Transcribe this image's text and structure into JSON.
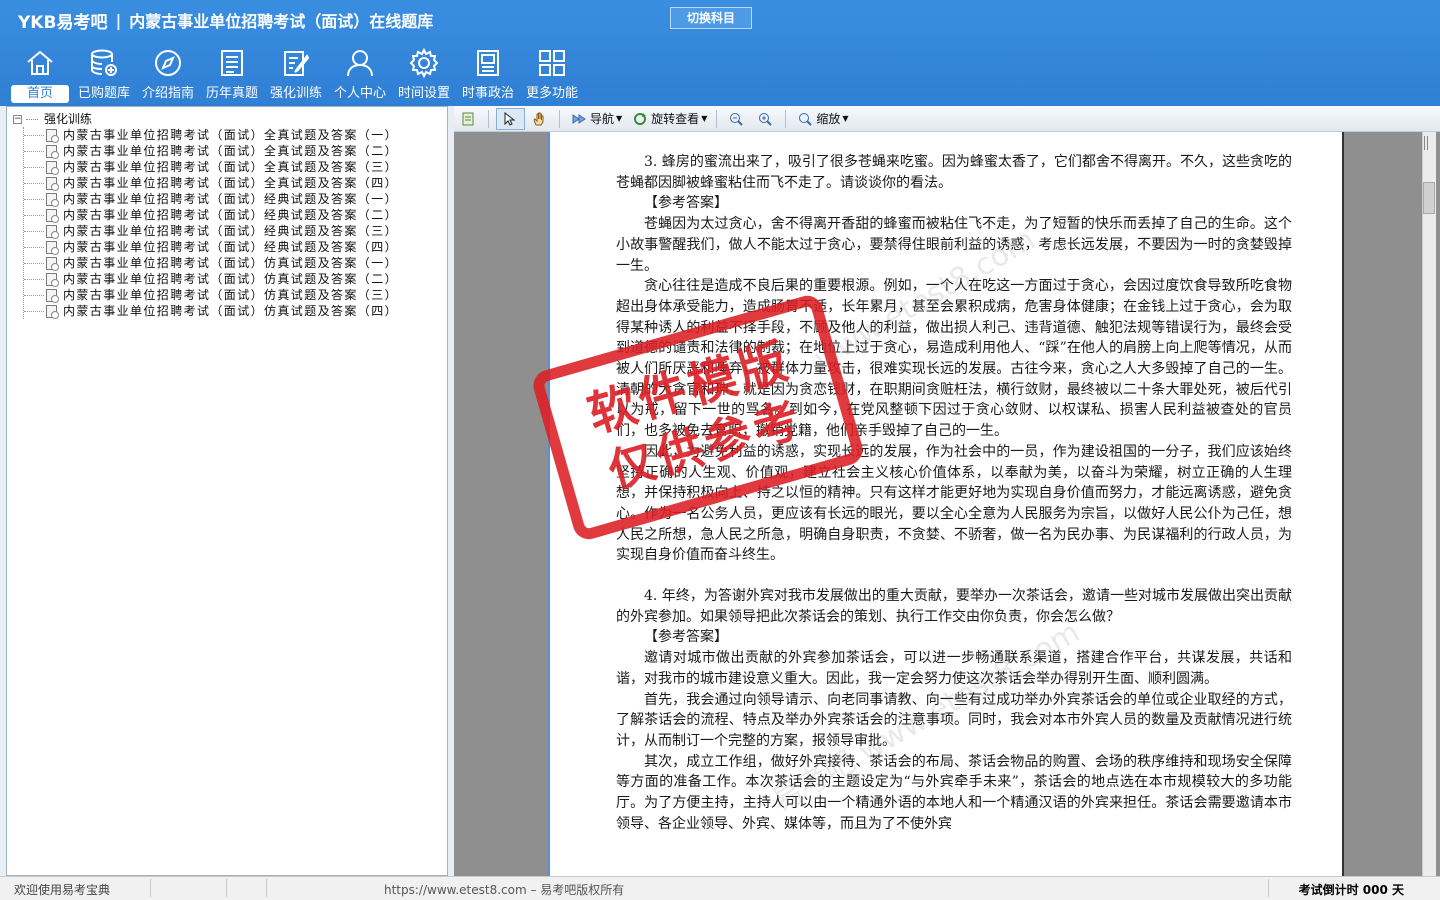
{
  "header": {
    "brand": "YKB易考吧",
    "separator": "|",
    "title": "内蒙古事业单位招聘考试（面试）在线题库",
    "switch_label": "切换科目"
  },
  "nav": [
    {
      "label": "首页",
      "icon": "home-icon"
    },
    {
      "label": "已购题库",
      "icon": "database-icon"
    },
    {
      "label": "介绍指南",
      "icon": "compass-icon"
    },
    {
      "label": "历年真题",
      "icon": "document-list-icon"
    },
    {
      "label": "强化训练",
      "icon": "edit-icon"
    },
    {
      "label": "个人中心",
      "icon": "user-icon"
    },
    {
      "label": "时间设置",
      "icon": "gear-icon"
    },
    {
      "label": "时事政治",
      "icon": "book-icon"
    },
    {
      "label": "更多功能",
      "icon": "grid-icon"
    }
  ],
  "tree": {
    "root": "强化训练",
    "items": [
      "内蒙古事业单位招聘考试（面试）全真试题及答案（一）",
      "内蒙古事业单位招聘考试（面试）全真试题及答案（二）",
      "内蒙古事业单位招聘考试（面试）全真试题及答案（三）",
      "内蒙古事业单位招聘考试（面试）全真试题及答案（四）",
      "内蒙古事业单位招聘考试（面试）经典试题及答案（一）",
      "内蒙古事业单位招聘考试（面试）经典试题及答案（二）",
      "内蒙古事业单位招聘考试（面试）经典试题及答案（三）",
      "内蒙古事业单位招聘考试（面试）经典试题及答案（四）",
      "内蒙古事业单位招聘考试（面试）仿真试题及答案（一）",
      "内蒙古事业单位招聘考试（面试）仿真试题及答案（二）",
      "内蒙古事业单位招聘考试（面试）仿真试题及答案（三）",
      "内蒙古事业单位招聘考试（面试）仿真试题及答案（四）"
    ]
  },
  "toolbar": {
    "nav_label": "导航",
    "rotate_label": "旋转查看",
    "zoom_label": "缩放"
  },
  "document": {
    "paragraphs": [
      {
        "text": "3. 蜂房的蜜流出来了，吸引了很多苍蝇来吃蜜。因为蜂蜜太香了，它们都舍不得离开。不久，这些贪吃的苍蝇都因脚被蜂蜜粘住而飞不走了。请谈谈你的看法。",
        "indent": true
      },
      {
        "text": "【参考答案】",
        "indent": true
      },
      {
        "text": "苍蝇因为太过贪心，舍不得离开香甜的蜂蜜而被粘住飞不走，为了短暂的快乐而丢掉了自己的生命。这个小故事警醒我们，做人不能太过于贪心，要禁得住眼前利益的诱惑，考虑长远发展，不要因为一时的贪婪毁掉一生。",
        "indent": true
      },
      {
        "text": "贪心往往是造成不良后果的重要根源。例如，一个人在吃这一方面过于贪心，会因过度饮食导致所吃食物超出身体承受能力，造成肠胃不适，长年累月，甚至会累积成病，危害身体健康；在金钱上过于贪心，会为取得某种诱人的利益不择手段，不顾及他人的利益，做出损人利己、违背道德、触犯法规等错误行为，最终会受到道德的谴责和法律的制裁；在地位上过于贪心，易造成利用他人、“踩”在他人的肩膀上向上爬等情况，从而被人们所厌恶和唾弃，被群体力量攻击，很难实现长远的发展。古往今来，贪心之人大多毁掉了自己的一生。清朝的大贪官和珅，就是因为贪恋钱财，在职期间贪赃枉法，横行敛财，最终被以二十条大罪处死，被后代引以为戒，留下一世的骂名。到如今，在党风整顿下因过于贪心敛财、以权谋私、损害人民利益被查处的官员们，也多被免去官职，撤销党籍，他们亲手毁掉了自己的一生。",
        "indent": true
      },
      {
        "text": "因此，为避免利益的诱惑，实现长远的发展，作为社会中的一员，作为建设祖国的一分子，我们应该始终坚持正确的人生观、价值观，建立社会主义核心价值体系，以奉献为美，以奋斗为荣耀，树立正确的人生理想，并保持积极向上、持之以恒的精神。只有这样才能更好地为实现自身价值而努力，才能远离诱惑，避免贪心。作为一名公务人员，更应该有长远的眼光，要以全心全意为人民服务为宗旨，以做好人民公仆为己任，想人民之所想，急人民之所急，明确自身职责，不贪婪、不骄奢，做一名为民办事、为民谋福利的行政人员，为实现自身价值而奋斗终生。",
        "indent": true
      },
      {
        "text": "",
        "gap": true
      },
      {
        "text": "4. 年终，为答谢外宾对我市发展做出的重大贡献，要举办一次茶话会，邀请一些对城市发展做出突出贡献的外宾参加。如果领导把此次茶话会的策划、执行工作交由你负责，你会怎么做？",
        "indent": true
      },
      {
        "text": "【参考答案】",
        "indent": true
      },
      {
        "text": "邀请对城市做出贡献的外宾参加茶话会，可以进一步畅通联系渠道，搭建合作平台，共谋发展，共话和谐，对我市的城市建设意义重大。因此，我一定会努力使这次茶话会举办得别开生面、顺利圆满。",
        "indent": true
      },
      {
        "text": "首先，我会通过向领导请示、向老同事请教、向一些有过成功举办外宾茶话会的单位或企业取经的方式，了解茶话会的流程、特点及举办外宾茶话会的注意事项。同时，我会对本市外宾人员的数量及贡献情况进行统计，从而制订一个完整的方案，报领导审批。",
        "indent": true
      },
      {
        "text": "其次，成立工作组，做好外宾接待、茶话会的布局、茶话会物品的购置、会场的秩序维持和现场安全保障等方面的准备工作。本次茶话会的主题设定为“与外宾牵手未来”，茶话会的地点选在本市规模较大的多功能厅。为了方便主持，主持人可以由一个精通外语的本地人和一个精通汉语的外宾来担任。茶话会需要邀请本市领导、各企业领导、外宾、媒体等，而且为了不使外宾",
        "indent": true
      }
    ]
  },
  "stamp": {
    "line1": "软件模版",
    "line2": "仅供参考"
  },
  "watermarks": [
    "www.etest8.com",
    "易考吧 www.etest8.com"
  ],
  "status": {
    "welcome": "欢迎使用易考宝典",
    "copyright": "https://www.etest8.com – 易考吧版权所有",
    "countdown": "考试倒计时 000 天"
  },
  "colors": {
    "header": "#2f7fd4",
    "stamp": "#dc1e23"
  }
}
